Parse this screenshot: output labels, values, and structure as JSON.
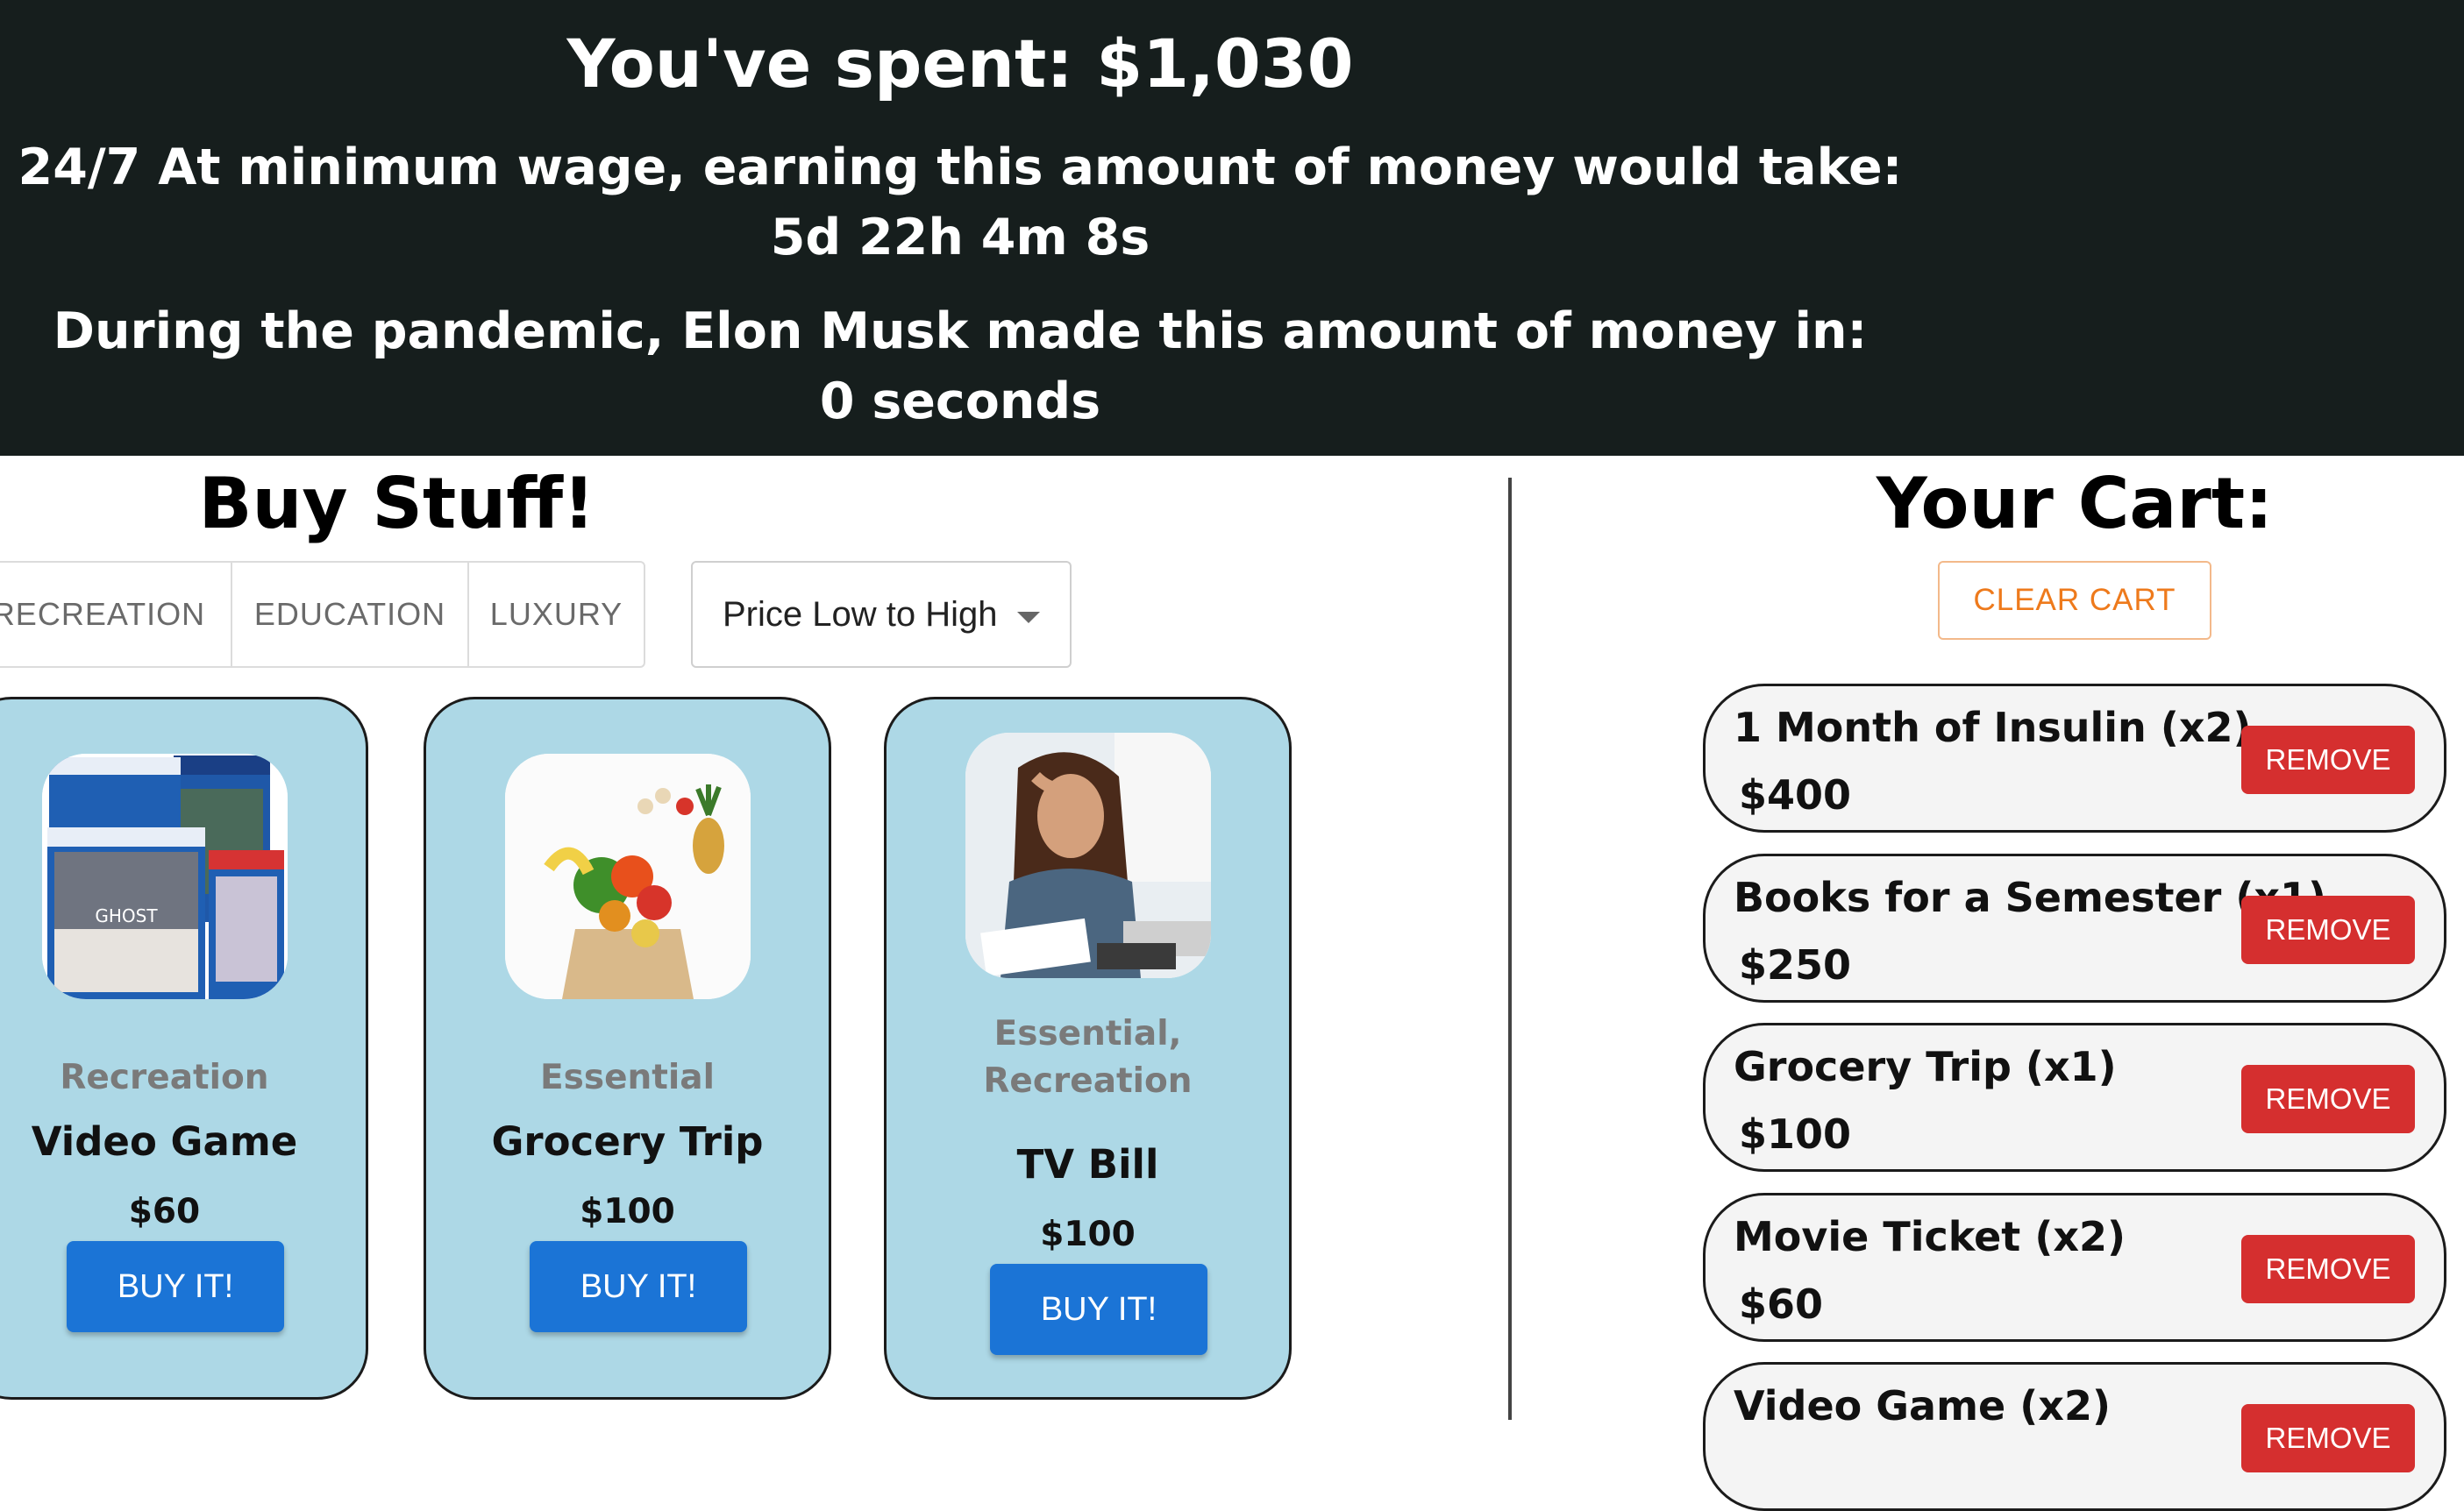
{
  "header": {
    "spent": "You've spent: $1,030",
    "wage_line": "24/7 At minimum wage, earning this amount of money would take:",
    "wage_time": "5d 22h 4m 8s",
    "musk_line": "During the pandemic, Elon Musk made this amount of money in:",
    "musk_time": "0 seconds"
  },
  "shop": {
    "title": "Buy Stuff!",
    "tabs": [
      "RECREATION",
      "EDUCATION",
      "LUXURY"
    ],
    "sort_value": "Price Low to High",
    "buy_label": "BUY IT!",
    "products": [
      {
        "category": "Recreation",
        "name": "Video Game",
        "price": "$60",
        "icon": "video-game-boxes-image"
      },
      {
        "category": "Essential",
        "name": "Grocery Trip",
        "price": "$100",
        "icon": "groceries-bag-image"
      },
      {
        "category": "Essential,\nRecreation",
        "category_line1": "Essential,",
        "category_line2": "Recreation",
        "name": "TV Bill",
        "price": "$100",
        "icon": "stressed-woman-bills-image"
      }
    ]
  },
  "cart": {
    "title": "Your Cart:",
    "clear_label": "CLEAR CART",
    "remove_label": "REMOVE",
    "items": [
      {
        "name": "1 Month of Insulin (x2)",
        "price": "$400"
      },
      {
        "name": "Books for a Semester (x1)",
        "price": "$250"
      },
      {
        "name": "Grocery Trip (x1)",
        "price": "$100"
      },
      {
        "name": "Movie Ticket (x2)",
        "price": "$60"
      },
      {
        "name": "Video Game (x2)",
        "price": ""
      }
    ]
  },
  "colors": {
    "header_bg": "#161e1d",
    "card_bg": "#add8e6",
    "buy_button": "#1b74d6",
    "remove_button": "#d52f2f",
    "clear_cart": "#ee7a1c"
  }
}
